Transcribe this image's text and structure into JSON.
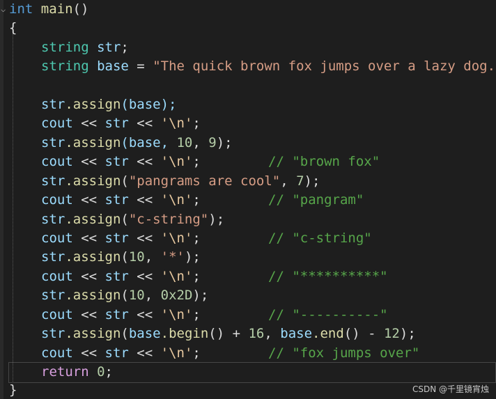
{
  "code": {
    "l1": {
      "kw": "int",
      "fn": "main",
      "rest": "()"
    },
    "l2": "{",
    "l3": {
      "type": "string",
      "var": "str",
      "end": ";"
    },
    "l4": {
      "type": "string",
      "var": "base",
      "op": " = ",
      "str": "\"The quick brown fox jumps over a lazy dog.\""
    },
    "l6": {
      "obj": "str",
      "method": ".assign",
      "args": "(base);"
    },
    "l7": {
      "cout": "cout",
      "op": " << ",
      "var": "str",
      "op2": " << ",
      "chr": "'\\n'",
      "end": ";"
    },
    "l8": {
      "obj": "str",
      "method": ".assign",
      "args": "(base, ",
      "n1": "10",
      "sep": ", ",
      "n2": "9",
      "end": ");"
    },
    "l9": {
      "cout": "cout",
      "op": " << ",
      "var": "str",
      "op2": " << ",
      "chr": "'\\n'",
      "end": ";",
      "comment": "// \"brown fox\""
    },
    "l10": {
      "obj": "str",
      "method": ".assign",
      "open": "(",
      "str": "\"pangrams are cool\"",
      "sep": ", ",
      "n1": "7",
      "end": ");"
    },
    "l11": {
      "cout": "cout",
      "op": " << ",
      "var": "str",
      "op2": " << ",
      "chr": "'\\n'",
      "end": ";",
      "comment": "// \"pangram\""
    },
    "l12": {
      "obj": "str",
      "method": ".assign",
      "open": "(",
      "str": "\"c-string\"",
      "end": ");"
    },
    "l13": {
      "cout": "cout",
      "op": " << ",
      "var": "str",
      "op2": " << ",
      "chr": "'\\n'",
      "end": ";",
      "comment": "// \"c-string\""
    },
    "l14": {
      "obj": "str",
      "method": ".assign",
      "open": "(",
      "n1": "10",
      "sep": ", ",
      "chr": "'*'",
      "end": ");"
    },
    "l15": {
      "cout": "cout",
      "op": " << ",
      "var": "str",
      "op2": " << ",
      "chr": "'\\n'",
      "end": ";",
      "comment": "// \"**********\""
    },
    "l16": {
      "obj": "str",
      "method": ".assign",
      "open": "(",
      "n1": "10",
      "sep": ", ",
      "n2": "0x2D",
      "end": ");"
    },
    "l17": {
      "cout": "cout",
      "op": " << ",
      "var": "str",
      "op2": " << ",
      "chr": "'\\n'",
      "end": ";",
      "comment": "// \"----------\""
    },
    "l18": {
      "obj": "str",
      "method": ".assign",
      "open": "(",
      "v1": "base",
      "m1": ".begin",
      "p1": "() + ",
      "n1": "16",
      "sep": ", ",
      "v2": "base",
      "m2": ".end",
      "p2": "() - ",
      "n2": "12",
      "end": ");"
    },
    "l19": {
      "cout": "cout",
      "op": " << ",
      "var": "str",
      "op2": " << ",
      "chr": "'\\n'",
      "end": ";",
      "comment": "// \"fox jumps over\""
    },
    "l20": {
      "kw": "return",
      "num": "0",
      "end": ";"
    },
    "l21": "}"
  },
  "watermark": "CSDN @千里镜宵烛",
  "colors": {
    "background": "#1e1e1e",
    "keyword": "#569cd6",
    "type": "#4ec9b0",
    "function": "#dcdcaa",
    "variable": "#9cdcfe",
    "string": "#d69d85",
    "comment": "#57a64a",
    "number": "#b5cea8"
  },
  "icons": {
    "fold": "chevron-down-icon"
  }
}
